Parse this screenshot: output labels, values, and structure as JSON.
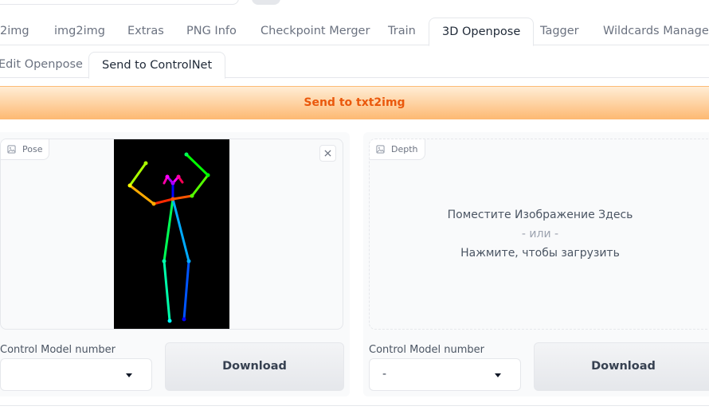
{
  "main_tabs": [
    {
      "label": "2img",
      "active": false
    },
    {
      "label": "img2img",
      "active": false
    },
    {
      "label": "Extras",
      "active": false
    },
    {
      "label": "PNG Info",
      "active": false
    },
    {
      "label": "Checkpoint Merger",
      "active": false
    },
    {
      "label": "Train",
      "active": false
    },
    {
      "label": "3D Openpose",
      "active": true
    },
    {
      "label": "Tagger",
      "active": false
    },
    {
      "label": "Wildcards Manager",
      "active": false
    }
  ],
  "sub_tabs": [
    {
      "label": "Edit Openpose",
      "active": false
    },
    {
      "label": "Send to ControlNet",
      "active": true
    }
  ],
  "send_button": "Send to txt2img",
  "pose_panel": {
    "badge": "Pose",
    "control_label": "Control Model number",
    "select_value": "",
    "download": "Download"
  },
  "depth_panel": {
    "badge": "Depth",
    "drop_text": "Поместите Изображение Здесь",
    "or_text": "- или -",
    "click_text": "Нажмите, чтобы загрузить",
    "control_label": "Control Model number",
    "select_value": "-",
    "download": "Download"
  },
  "icons": {
    "badge_icon": "image-icon",
    "close_icon": "close-icon",
    "select_caret": "caret-down-icon"
  },
  "colors": {
    "send_text": "#ea580c",
    "send_bg_top": "#ffedd5",
    "send_bg_bottom": "#fdba74"
  }
}
